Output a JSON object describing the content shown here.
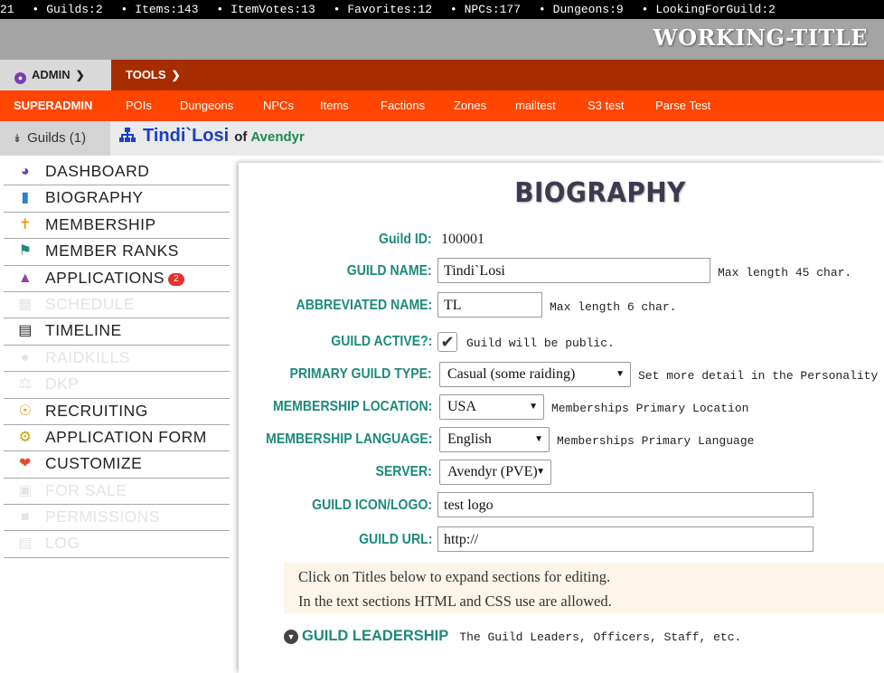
{
  "stats_bar": {
    "items": [
      "21",
      "Guilds:2",
      "Items:143",
      "ItemVotes:13",
      "Favorites:12",
      "NPCs:177",
      "Dungeons:9",
      "LookingForGuild:2"
    ],
    "bullet": "•"
  },
  "banner": {
    "brand": "WORKING-TITLE"
  },
  "top_menu": {
    "admin_label": "ADMIN",
    "tools_label": "TOOLS",
    "admin_icon": "user-shield-icon"
  },
  "sub_menu": {
    "items": [
      "SUPERADMIN",
      "POIs",
      "Dungeons",
      "NPCs",
      "Items",
      "Factions",
      "Zones",
      "mailtest",
      "S3 test",
      "Parse Test"
    ]
  },
  "breadcrumb": {
    "guilds_button": "Guilds (1)",
    "guild_name": "Tindi`Losi",
    "of_label": "of",
    "server_name": "Avendyr"
  },
  "sidebar": {
    "items": [
      {
        "label": "DASHBOARD",
        "icon": "tachometer-icon",
        "enabled": true,
        "color": "#6a3db8"
      },
      {
        "label": "BIOGRAPHY",
        "icon": "document-icon",
        "enabled": true,
        "color": "#2b7fd9"
      },
      {
        "label": "MEMBERSHIP",
        "icon": "person-icon",
        "enabled": true,
        "color": "#f29a1a"
      },
      {
        "label": "MEMBER RANKS",
        "icon": "bookmark-icon",
        "enabled": true,
        "color": "#1d8a7a"
      },
      {
        "label": "APPLICATIONS",
        "icon": "folder-open-icon",
        "enabled": true,
        "color": "#8e44ad",
        "badge": "2"
      },
      {
        "label": "SCHEDULE",
        "icon": "calendar-icon",
        "enabled": false
      },
      {
        "label": "TIMELINE",
        "icon": "newspaper-icon",
        "enabled": true,
        "color": "#222222"
      },
      {
        "label": "RAIDKILLS",
        "icon": "bomb-icon",
        "enabled": false
      },
      {
        "label": "DKP",
        "icon": "scale-icon",
        "enabled": false
      },
      {
        "label": "RECRUITING",
        "icon": "podcast-icon",
        "enabled": true,
        "color": "#f29a1a"
      },
      {
        "label": "APPLICATION FORM",
        "icon": "cogs-icon",
        "enabled": true,
        "color": "#c9a300"
      },
      {
        "label": "CUSTOMIZE",
        "icon": "heart-icon",
        "enabled": true,
        "color": "#e84c2a"
      },
      {
        "label": "FOR SALE",
        "icon": "cart-icon",
        "enabled": false
      },
      {
        "label": "PERMISSIONS",
        "icon": "lock-icon",
        "enabled": false
      },
      {
        "label": "LOG",
        "icon": "log-icon",
        "enabled": false
      }
    ]
  },
  "form": {
    "heading": "BIOGRAPHY",
    "guild_id_label": "Guild ID:",
    "guild_id_value": "100001",
    "guild_name_label": "GUILD NAME:",
    "guild_name_value": "Tindi`Losi",
    "guild_name_hint": "Max length 45 char.",
    "abbrev_label": "ABBREVIATED NAME:",
    "abbrev_value": "TL",
    "abbrev_hint": "Max length 6 char.",
    "active_label": "GUILD ACTIVE?:",
    "active_checked": true,
    "active_hint": "Guild will be public.",
    "type_label": "PRIMARY GUILD TYPE:",
    "type_value": "Casual (some raiding)",
    "type_hint": "Set more detail in the Personality",
    "location_label": "MEMBERSHIP LOCATION:",
    "location_value": "USA",
    "location_hint": "Memberships Primary Location",
    "language_label": "MEMBERSHIP LANGUAGE:",
    "language_value": "English",
    "language_hint": "Memberships Primary Language",
    "server_label": "SERVER:",
    "server_value": "Avendyr (PVE)",
    "icon_label": "GUILD ICON/LOGO:",
    "icon_value": "test logo",
    "url_label": "GUILD URL:",
    "url_value": "http://"
  },
  "note": {
    "line1": "Click on Titles below to expand sections for editing.",
    "line2": "In the text sections HTML and CSS use are allowed."
  },
  "section": {
    "title": "GUILD LEADERSHIP",
    "description": "The Guild Leaders, Officers, Staff, etc."
  }
}
